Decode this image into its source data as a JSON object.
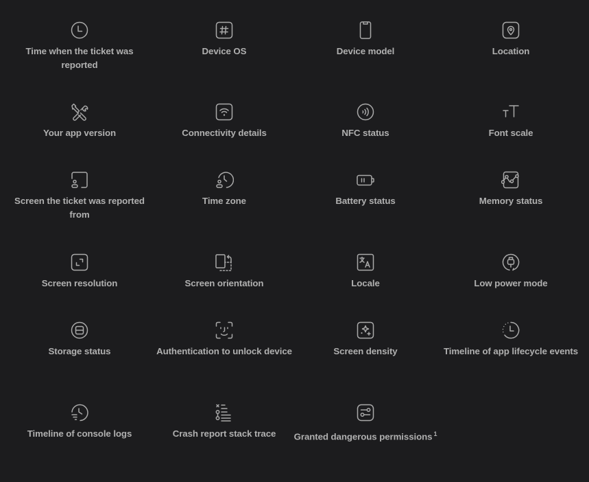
{
  "background_color": "#1c1c1e",
  "text_color": "#b0b0b0",
  "items": [
    {
      "label": "Time when the ticket was reported",
      "icon": "clock-icon"
    },
    {
      "label": "Device OS",
      "icon": "hash-icon"
    },
    {
      "label": "Device model",
      "icon": "phone-icon"
    },
    {
      "label": "Location",
      "icon": "location-pin-icon"
    },
    {
      "label": "Your app version",
      "icon": "tools-icon"
    },
    {
      "label": "Connectivity details",
      "icon": "wifi-icon"
    },
    {
      "label": "NFC status",
      "icon": "nfc-icon"
    },
    {
      "label": "Font scale",
      "icon": "font-size-icon"
    },
    {
      "label": "Screen the ticket was reported from",
      "icon": "screen-user-icon"
    },
    {
      "label": "Time zone",
      "icon": "user-clock-icon"
    },
    {
      "label": "Battery status",
      "icon": "battery-icon"
    },
    {
      "label": "Memory status",
      "icon": "memory-chart-icon"
    },
    {
      "label": "Screen resolution",
      "icon": "resize-icon"
    },
    {
      "label": "Screen orientation",
      "icon": "rotate-screen-icon"
    },
    {
      "label": "Locale",
      "icon": "translate-icon"
    },
    {
      "label": "Low power mode",
      "icon": "power-plug-icon"
    },
    {
      "label": "Storage status",
      "icon": "storage-icon"
    },
    {
      "label": "Authentication to unlock device",
      "icon": "face-id-icon"
    },
    {
      "label": "Screen density",
      "icon": "sparkles-icon"
    },
    {
      "label": "Timeline of app lifecycle events",
      "icon": "timeline-clock-icon"
    },
    {
      "label": "Timeline of console logs",
      "icon": "history-logs-icon"
    },
    {
      "label": "Crash report stack trace",
      "icon": "stack-trace-icon"
    },
    {
      "label": "Granted dangerous permissions",
      "footnote": "1",
      "icon": "toggles-icon"
    }
  ]
}
